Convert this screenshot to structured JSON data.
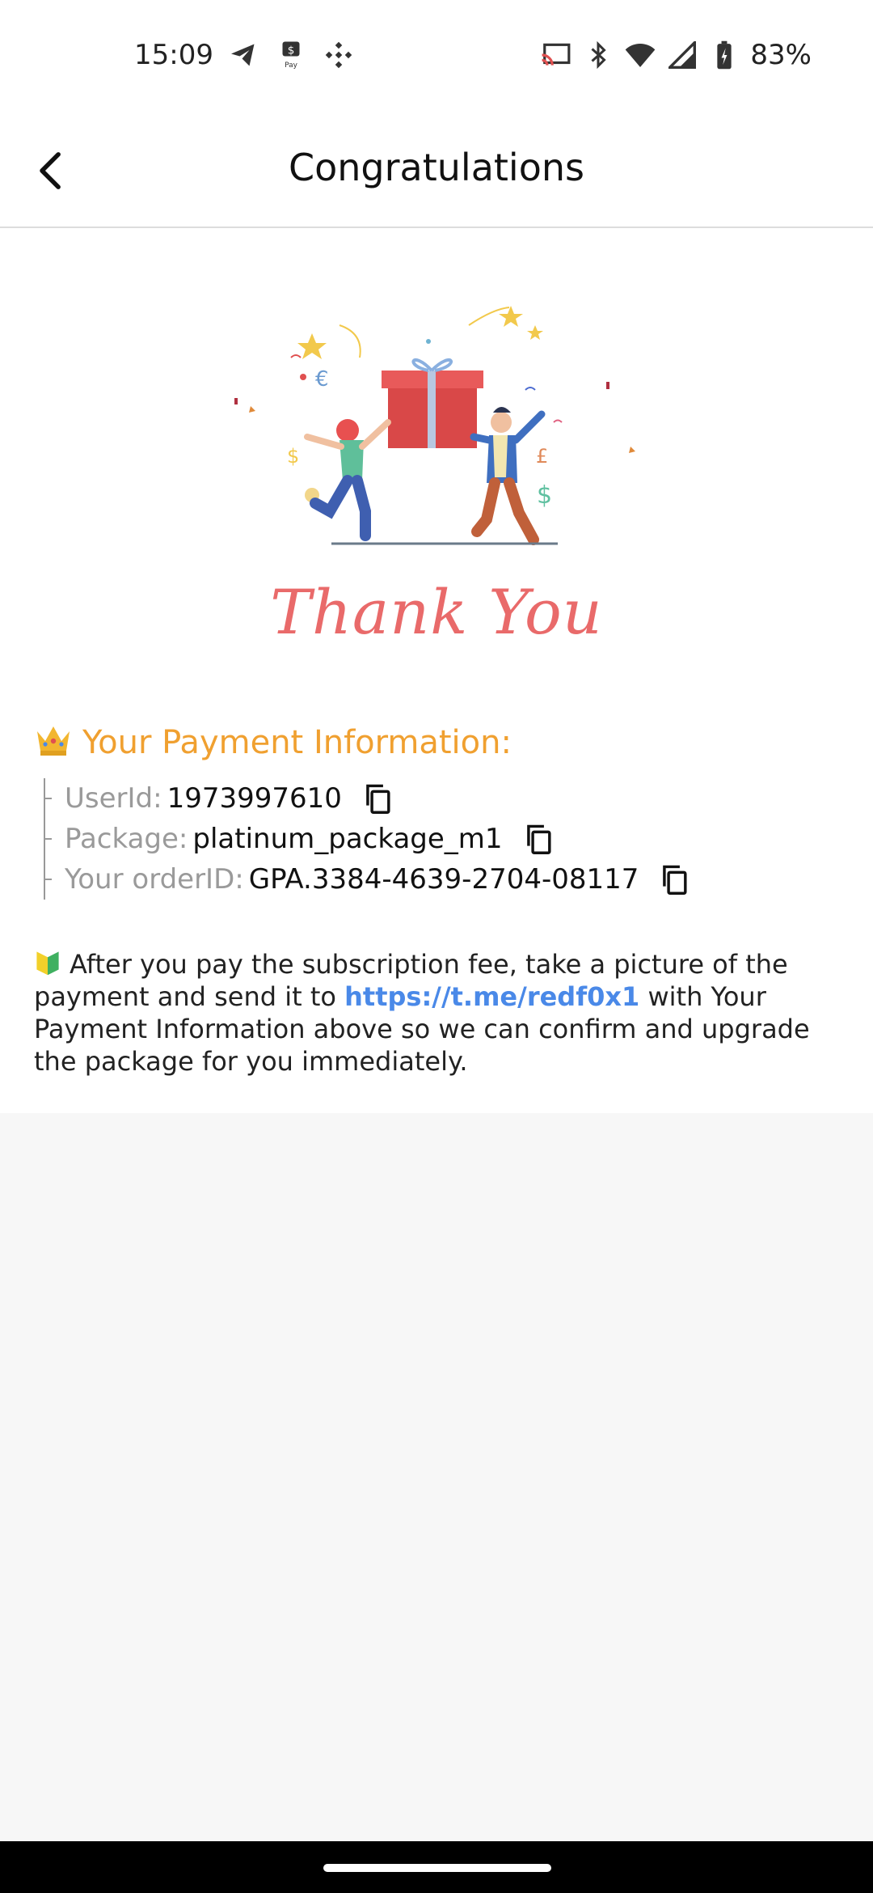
{
  "status_bar": {
    "time": "15:09",
    "battery": "83%",
    "left_icons": [
      "telegram-icon",
      "samsung-pay-icon",
      "binance-icon"
    ],
    "right_icons": [
      "cast-icon",
      "bluetooth-icon",
      "wifi-icon",
      "signal-icon",
      "battery-charging-icon"
    ]
  },
  "app_bar": {
    "title": "Congratulations"
  },
  "hero": {
    "thank_you": "Thank You"
  },
  "payment_info": {
    "heading": "Your Payment Information:",
    "rows": [
      {
        "label": "UserId:",
        "value": "1973997610"
      },
      {
        "label": "Package:",
        "value": "platinum_package_m1"
      },
      {
        "label": "Your orderID:",
        "value": "GPA.3384-4639-2704-08117"
      }
    ]
  },
  "notice": {
    "text_before": "After you pay the subscription fee, take a picture of the payment and send it to ",
    "link": "https://t.me/redf0x1",
    "text_after": " with Your Payment Information above so we can confirm and upgrade the package for you immediately."
  },
  "colors": {
    "accent_orange": "#f0a030",
    "link_blue": "#4a89e8",
    "thank_you_red": "#e96a6a"
  }
}
